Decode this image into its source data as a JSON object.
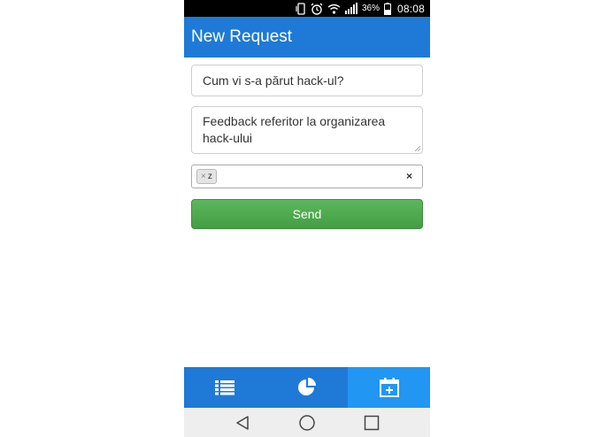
{
  "status_bar": {
    "battery_percent": "36%",
    "time": "08:08",
    "icons": [
      "rotation-lock-icon",
      "alarm-icon",
      "wifi-icon",
      "signal-icon",
      "battery-icon"
    ]
  },
  "app_bar": {
    "title": "New Request"
  },
  "form": {
    "title_value": "Cum vi s-a părut hack-ul?",
    "description_value": "Feedback referitor la organizarea hack-ului",
    "tags": [
      {
        "label": "z",
        "remove_symbol": "×"
      }
    ],
    "clear_symbol": "×",
    "send_label": "Send"
  },
  "bottom_nav": {
    "items": [
      {
        "icon": "list-icon",
        "active": false
      },
      {
        "icon": "pie-chart-icon",
        "active": false
      },
      {
        "icon": "calendar-add-icon",
        "active": true
      }
    ]
  },
  "system_nav": {
    "icons": [
      "back-icon",
      "home-icon",
      "recents-icon"
    ]
  },
  "colors": {
    "app_bar": "#1e7ad6",
    "active_tab": "#2196f3",
    "send_button": "#4cae4c"
  }
}
